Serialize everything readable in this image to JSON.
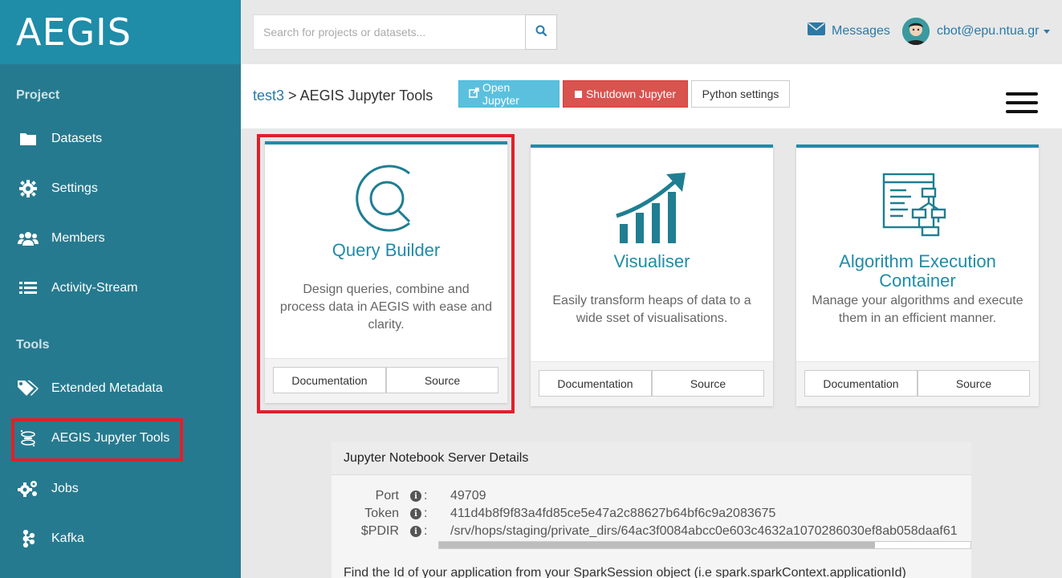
{
  "brand": "AEGIS",
  "sidebar": {
    "project_title": "Project",
    "tools_title": "Tools",
    "project_items": [
      {
        "label": "Datasets",
        "icon": "folder-icon"
      },
      {
        "label": "Settings",
        "icon": "gear-icon"
      },
      {
        "label": "Members",
        "icon": "users-icon"
      },
      {
        "label": "Activity-Stream",
        "icon": "list-icon"
      }
    ],
    "tool_items": [
      {
        "label": "Extended Metadata",
        "icon": "tags-icon"
      },
      {
        "label": "AEGIS Jupyter Tools",
        "icon": "jupyter-icon"
      },
      {
        "label": "Jobs",
        "icon": "gears-icon"
      },
      {
        "label": "Kafka",
        "icon": "kafka-icon"
      }
    ]
  },
  "topbar": {
    "search_placeholder": "Search for projects or datasets...",
    "messages_label": "Messages",
    "user_email": "cbot@epu.ntua.gr"
  },
  "header": {
    "breadcrumb_project": "test3",
    "breadcrumb_sep": " > ",
    "breadcrumb_page": "AEGIS Jupyter Tools",
    "open_jupyter": "Open Jupyter",
    "shutdown_jupyter": "Shutdown Jupyter",
    "python_settings": "Python settings"
  },
  "cards": [
    {
      "title": "Query Builder",
      "desc": "Design queries, combine and process data in AEGIS with ease and clarity.",
      "doc": "Documentation",
      "src": "Source"
    },
    {
      "title": "Visualiser",
      "desc": "Easily transform heaps of data to a wide sset of visualisations.",
      "doc": "Documentation",
      "src": "Source"
    },
    {
      "title": "Algorithm Execution Container",
      "desc": "Manage your algorithms and execute them in an efficient manner.",
      "doc": "Documentation",
      "src": "Source"
    }
  ],
  "details": {
    "title": "Jupyter Notebook Server Details",
    "rows": [
      {
        "label": "Port",
        "value": "49709"
      },
      {
        "label": "Token",
        "value": "411d4b8f9f83a4fd85ce5e47a2c88627b64bf6c9a2083675"
      },
      {
        "label": "$PDIR",
        "value": "/srv/hops/staging/private_dirs/64ac3f0084abcc0e603c4632a1070286030ef8ab058daaf61"
      }
    ],
    "footnote": "Find the Id of your application from your SparkSession object (i.e spark.sparkContext.applicationId)"
  },
  "colors": {
    "accent": "#1f8ca8",
    "sidebar": "#267a8f",
    "highlight": "#e0202a"
  }
}
